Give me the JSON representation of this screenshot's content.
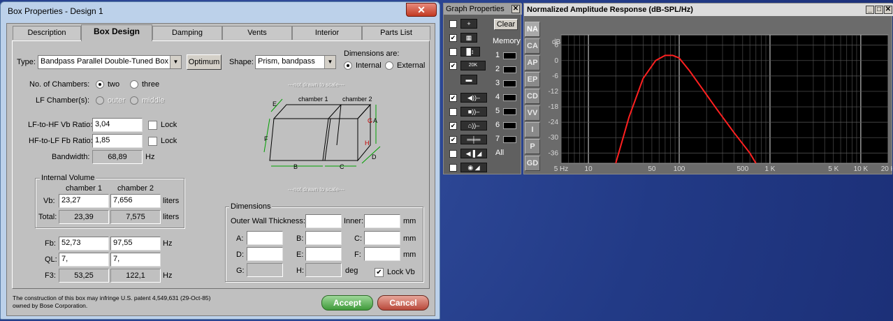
{
  "dialog": {
    "title": "Box Properties - Design 1",
    "close": "✕",
    "tabs": [
      "Description",
      "Box Design",
      "Damping",
      "Vents",
      "Interior",
      "Parts List"
    ],
    "type_label": "Type:",
    "type_value": "Bandpass Parallel Double-Tuned Box",
    "optimum": "Optimum",
    "shape_label": "Shape:",
    "shape_value": "Prism, bandpass",
    "dim_are": "Dimensions are:",
    "internal": "Internal",
    "external": "External",
    "num_chambers": "No. of Chambers:",
    "two": "two",
    "three": "three",
    "lf_chamber": "LF Chamber(s):",
    "outer": "outer",
    "middle": "middle",
    "vb_ratio_label": "LF-to-HF Vb Ratio:",
    "vb_ratio": "3,04",
    "fb_ratio_label": "HF-to-LF Fb Ratio:",
    "fb_ratio": "1,85",
    "lock": "Lock",
    "bandwidth_label": "Bandwidth:",
    "bandwidth": "68,89",
    "hz": "Hz",
    "internal_volume": "Internal Volume",
    "chamber1": "chamber 1",
    "chamber2": "chamber 2",
    "vb_label": "Vb:",
    "vb1": "23,27",
    "vb2": "7,656",
    "liters": "liters",
    "total_label": "Total:",
    "total1": "23,39",
    "total2": "7,575",
    "fb_label": "Fb:",
    "fb1": "52,73",
    "fb2": "97,55",
    "ql_label": "QL:",
    "ql1": "7,",
    "ql2": "7,",
    "f3_label": "F3:",
    "f31": "53,25",
    "f32": "122,1",
    "not_drawn": "---not drawn to scale---",
    "diagram_labels": {
      "c1": "chamber 1",
      "c2": "chamber 2",
      "A": "A",
      "B": "B",
      "C": "C",
      "D": "D",
      "E": "E",
      "F": "F",
      "G": "G",
      "H": "H"
    },
    "dimensions": "Dimensions",
    "outer_wall": "Outer Wall Thickness:",
    "inner": "Inner:",
    "mm": "mm",
    "deg": "deg",
    "a": "A:",
    "b": "B:",
    "c": "C:",
    "d": "D:",
    "e": "E:",
    "f": "F:",
    "g": "G:",
    "h": "H:",
    "lock_vb": "Lock Vb",
    "note": "The construction of this box may infringe U.S. patent 4,549,631 (29-Oct-85) owned by Bose Corporation.",
    "accept": "Accept",
    "cancel": "Cancel"
  },
  "graph_props": {
    "title": "Graph Properties",
    "close": "✕",
    "clear": "Clear",
    "memory": "Memory",
    "mem": [
      "1",
      "2",
      "3",
      "4",
      "5",
      "6",
      "7"
    ],
    "all": "All",
    "icon_20k": "20K"
  },
  "graph": {
    "title": "Normalized Amplitude Response (dB-SPL/Hz)",
    "side_tabs": [
      "NA",
      "CA",
      "AP",
      "EP",
      "CD",
      "VV",
      "I",
      "P",
      "GD"
    ],
    "y_unit": "dB",
    "y_ticks": [
      "6",
      "0",
      "-6",
      "-12",
      "-18",
      "-24",
      "-30",
      "-36"
    ],
    "x_ticks": [
      "5 Hz",
      "10",
      "50",
      "100",
      "500",
      "1 K",
      "5 K",
      "10 K",
      "20 K"
    ],
    "line_color": "#ff2020"
  },
  "chart_data": {
    "type": "line",
    "title": "Normalized Amplitude Response (dB-SPL/Hz)",
    "xlabel": "",
    "ylabel": "dB",
    "x_scale": "log",
    "xlim": [
      5,
      20000
    ],
    "ylim": [
      -40,
      10
    ],
    "series": [
      {
        "name": "",
        "x": [
          20,
          28,
          40,
          55,
          70,
          85,
          100,
          130,
          180,
          260,
          400,
          600,
          700
        ],
        "y": [
          -40,
          -22,
          -7,
          0,
          2,
          2,
          1,
          -4,
          -11,
          -19,
          -28,
          -36,
          -40
        ]
      }
    ]
  }
}
